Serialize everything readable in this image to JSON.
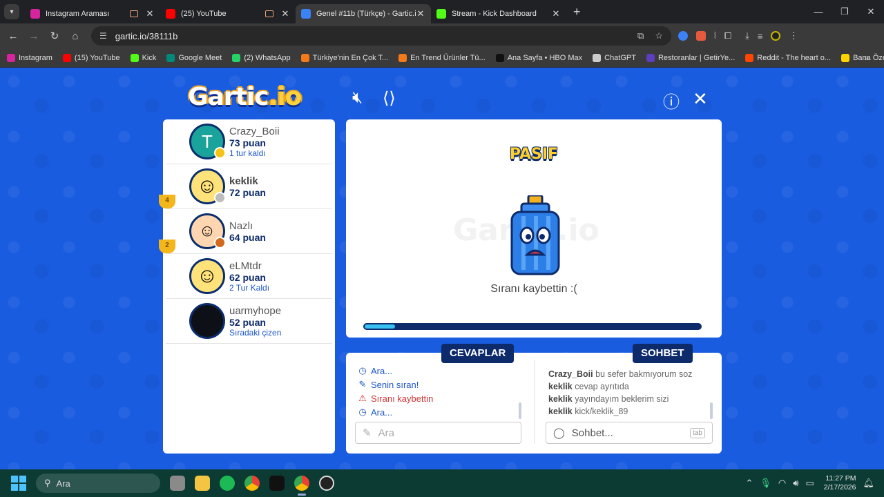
{
  "browser": {
    "tabs": [
      {
        "title": "Instagram Araması",
        "color": "#d6249f",
        "active": false
      },
      {
        "title": "(25) YouTube",
        "color": "#ff0000",
        "active": false
      },
      {
        "title": "Genel #11b (Türkçe) - Gartic.io",
        "color": "#3b82f6",
        "active": true
      },
      {
        "title": "Stream - Kick Dashboard",
        "color": "#53fc18",
        "active": false
      }
    ],
    "url": "gartic.io/38111b",
    "bookmarks": [
      {
        "label": "Instagram",
        "color": "#d6249f"
      },
      {
        "label": "(15) YouTube",
        "color": "#ff0000"
      },
      {
        "label": "Kick",
        "color": "#53fc18"
      },
      {
        "label": "Google Meet",
        "color": "#00897b"
      },
      {
        "label": "(2) WhatsApp",
        "color": "#25d366"
      },
      {
        "label": "Türkiye'nin En Çok T...",
        "color": "#f27a1a"
      },
      {
        "label": "En Trend Ürünler Tü...",
        "color": "#f27a1a"
      },
      {
        "label": "Ana Sayfa • HBO Max",
        "color": "#111111"
      },
      {
        "label": "ChatGPT",
        "color": "#cccccc"
      },
      {
        "label": "Restoranlar | GetirYe...",
        "color": "#5d3ebc"
      },
      {
        "label": "Reddit - The heart o...",
        "color": "#ff4500"
      },
      {
        "label": "Bana Özel Özet",
        "color": "#ffd400"
      }
    ]
  },
  "game": {
    "logo_main": "Gartic",
    "logo_suffix": ".io",
    "players": [
      {
        "name": "Crazy_Boii",
        "score": "73 puan",
        "note": "1 tur kaldı",
        "avatar_letter": "T",
        "avatar_style": "teal",
        "badge_color": "#f3c316",
        "trophy": ""
      },
      {
        "name": "keklik",
        "score": "72 puan",
        "note": "",
        "avatar_letter": "☺",
        "avatar_style": "face",
        "badge_color": "#bdbdbd",
        "trophy": "4"
      },
      {
        "name": "Nazlı",
        "score": "64 puan",
        "note": "",
        "avatar_letter": "☺",
        "avatar_style": "hair",
        "badge_color": "#d2691e",
        "trophy": "2"
      },
      {
        "name": "eLMtdr",
        "score": "62 puan",
        "note": "2 Tur Kaldı",
        "avatar_letter": "☺",
        "avatar_style": "face",
        "badge_color": "",
        "trophy": ""
      },
      {
        "name": "uarmyhope",
        "score": "52 puan",
        "note": "Sıradaki çizen",
        "avatar_letter": "",
        "avatar_style": "dark",
        "badge_color": "",
        "trophy": ""
      }
    ],
    "status_title": "PASIF",
    "watermark": "Gartic.io",
    "status_message": "Sıranı kaybettin :(",
    "progress_fraction": 0.09,
    "answers_label": "CEVAPLAR",
    "chat_label": "SOHBET",
    "answers": [
      {
        "icon": "clock",
        "text": "Ara...",
        "style": "blue"
      },
      {
        "icon": "pencil",
        "text": "Senin sıran!",
        "style": "blue"
      },
      {
        "icon": "warning",
        "text": "Sıranı kaybettin",
        "style": "red"
      },
      {
        "icon": "clock",
        "text": "Ara...",
        "style": "blue"
      }
    ],
    "chat": [
      {
        "user": "Crazy_Boii",
        "text": "bu sefer bakmıyorum soz"
      },
      {
        "user": "keklik",
        "text": "cevap ayrıtıda"
      },
      {
        "user": "keklik",
        "text": "yayındayım beklerim sizi"
      },
      {
        "user": "keklik",
        "text": "kick/keklik_89"
      }
    ],
    "answer_placeholder": "Ara",
    "chat_placeholder": "Sohbet...",
    "chat_key_hint": "tab"
  },
  "taskbar": {
    "search": "Ara",
    "time": "11:27 PM",
    "date": "2/17/2026"
  }
}
